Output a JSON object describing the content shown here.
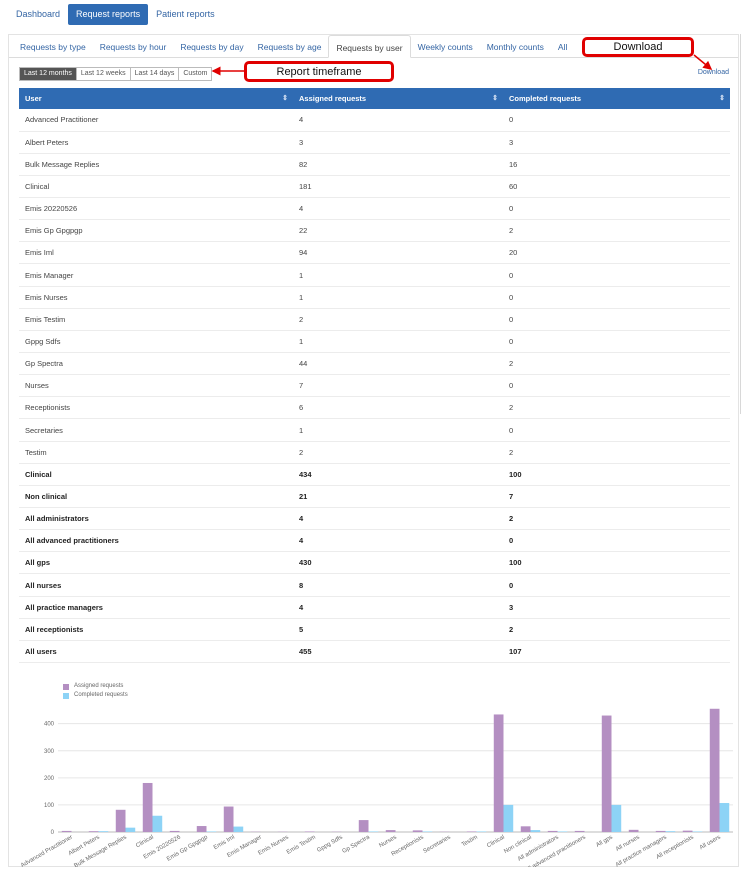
{
  "top_nav": [
    "Dashboard",
    "Request reports",
    "Patient reports"
  ],
  "tabs": [
    "Requests by type",
    "Requests by hour",
    "Requests by day",
    "Requests by age",
    "Requests by user",
    "Weekly counts",
    "Monthly counts",
    "All"
  ],
  "active_tab": "Requests by user",
  "timeframe_buttons": [
    "Last 12 months",
    "Last 12 weeks",
    "Last 14 days",
    "Custom"
  ],
  "download_link": "Download",
  "annotations": {
    "download": "Download",
    "timeframe": "Report timeframe",
    "color": "#e00000"
  },
  "table": {
    "headers": [
      "User",
      "Assigned requests",
      "Completed requests"
    ],
    "rows": [
      {
        "user": "Advanced Practitioner",
        "assigned": "4",
        "completed": "0"
      },
      {
        "user": "Albert Peters",
        "assigned": "3",
        "completed": "3"
      },
      {
        "user": "Bulk Message Replies",
        "assigned": "82",
        "completed": "16"
      },
      {
        "user": "Clinical",
        "assigned": "181",
        "completed": "60"
      },
      {
        "user": "Emis 20220526",
        "assigned": "4",
        "completed": "0"
      },
      {
        "user": "Emis Gp Gpgpgp",
        "assigned": "22",
        "completed": "2"
      },
      {
        "user": "Emis Iml",
        "assigned": "94",
        "completed": "20"
      },
      {
        "user": "Emis Manager",
        "assigned": "1",
        "completed": "0"
      },
      {
        "user": "Emis Nurses",
        "assigned": "1",
        "completed": "0"
      },
      {
        "user": "Emis Testim",
        "assigned": "2",
        "completed": "0"
      },
      {
        "user": "Gppg Sdfs",
        "assigned": "1",
        "completed": "0"
      },
      {
        "user": "Gp Spectra",
        "assigned": "44",
        "completed": "2"
      },
      {
        "user": "Nurses",
        "assigned": "7",
        "completed": "0"
      },
      {
        "user": "Receptionists",
        "assigned": "6",
        "completed": "2"
      },
      {
        "user": "Secretaries",
        "assigned": "1",
        "completed": "0"
      },
      {
        "user": "Testim",
        "assigned": "2",
        "completed": "2"
      }
    ],
    "totals": [
      {
        "user": "Clinical",
        "assigned": "434",
        "completed": "100"
      },
      {
        "user": "Non clinical",
        "assigned": "21",
        "completed": "7"
      },
      {
        "user": "All administrators",
        "assigned": "4",
        "completed": "2"
      },
      {
        "user": "All advanced practitioners",
        "assigned": "4",
        "completed": "0"
      },
      {
        "user": "All gps",
        "assigned": "430",
        "completed": "100"
      },
      {
        "user": "All nurses",
        "assigned": "8",
        "completed": "0"
      },
      {
        "user": "All practice managers",
        "assigned": "4",
        "completed": "3"
      },
      {
        "user": "All receptionists",
        "assigned": "5",
        "completed": "2"
      },
      {
        "user": "All users",
        "assigned": "455",
        "completed": "107"
      }
    ]
  },
  "chart_data": {
    "type": "bar",
    "categories": [
      "Advanced Practitioner",
      "Albert Peters",
      "Bulk Message Replies",
      "Clinical",
      "Emis 20220526",
      "Emis Gp Gpgpgp",
      "Emis Iml",
      "Emis Manager",
      "Emis Nurses",
      "Emis Testim",
      "Gppg Sdfs",
      "Gp Spectra",
      "Nurses",
      "Receptionists",
      "Secretaries",
      "Testim",
      "Clinical",
      "Non clinical",
      "All administrators",
      "All advanced practitioners",
      "All gps",
      "All nurses",
      "All practice managers",
      "All receptionists",
      "All users"
    ],
    "series": [
      {
        "name": "Assigned requests",
        "color": "#b48fc2",
        "values": [
          4,
          3,
          82,
          181,
          4,
          22,
          94,
          1,
          1,
          2,
          1,
          44,
          7,
          6,
          1,
          2,
          434,
          21,
          4,
          4,
          430,
          8,
          4,
          5,
          455
        ]
      },
      {
        "name": "Completed requests",
        "color": "#8dd3f6",
        "values": [
          0,
          3,
          16,
          60,
          0,
          2,
          20,
          0,
          0,
          0,
          0,
          2,
          0,
          2,
          0,
          2,
          100,
          7,
          2,
          0,
          100,
          0,
          3,
          2,
          107
        ]
      }
    ],
    "ylim": [
      0,
      480
    ],
    "yticks": [
      0,
      100,
      200,
      300,
      400
    ],
    "grid": true,
    "legend": "top-left"
  }
}
